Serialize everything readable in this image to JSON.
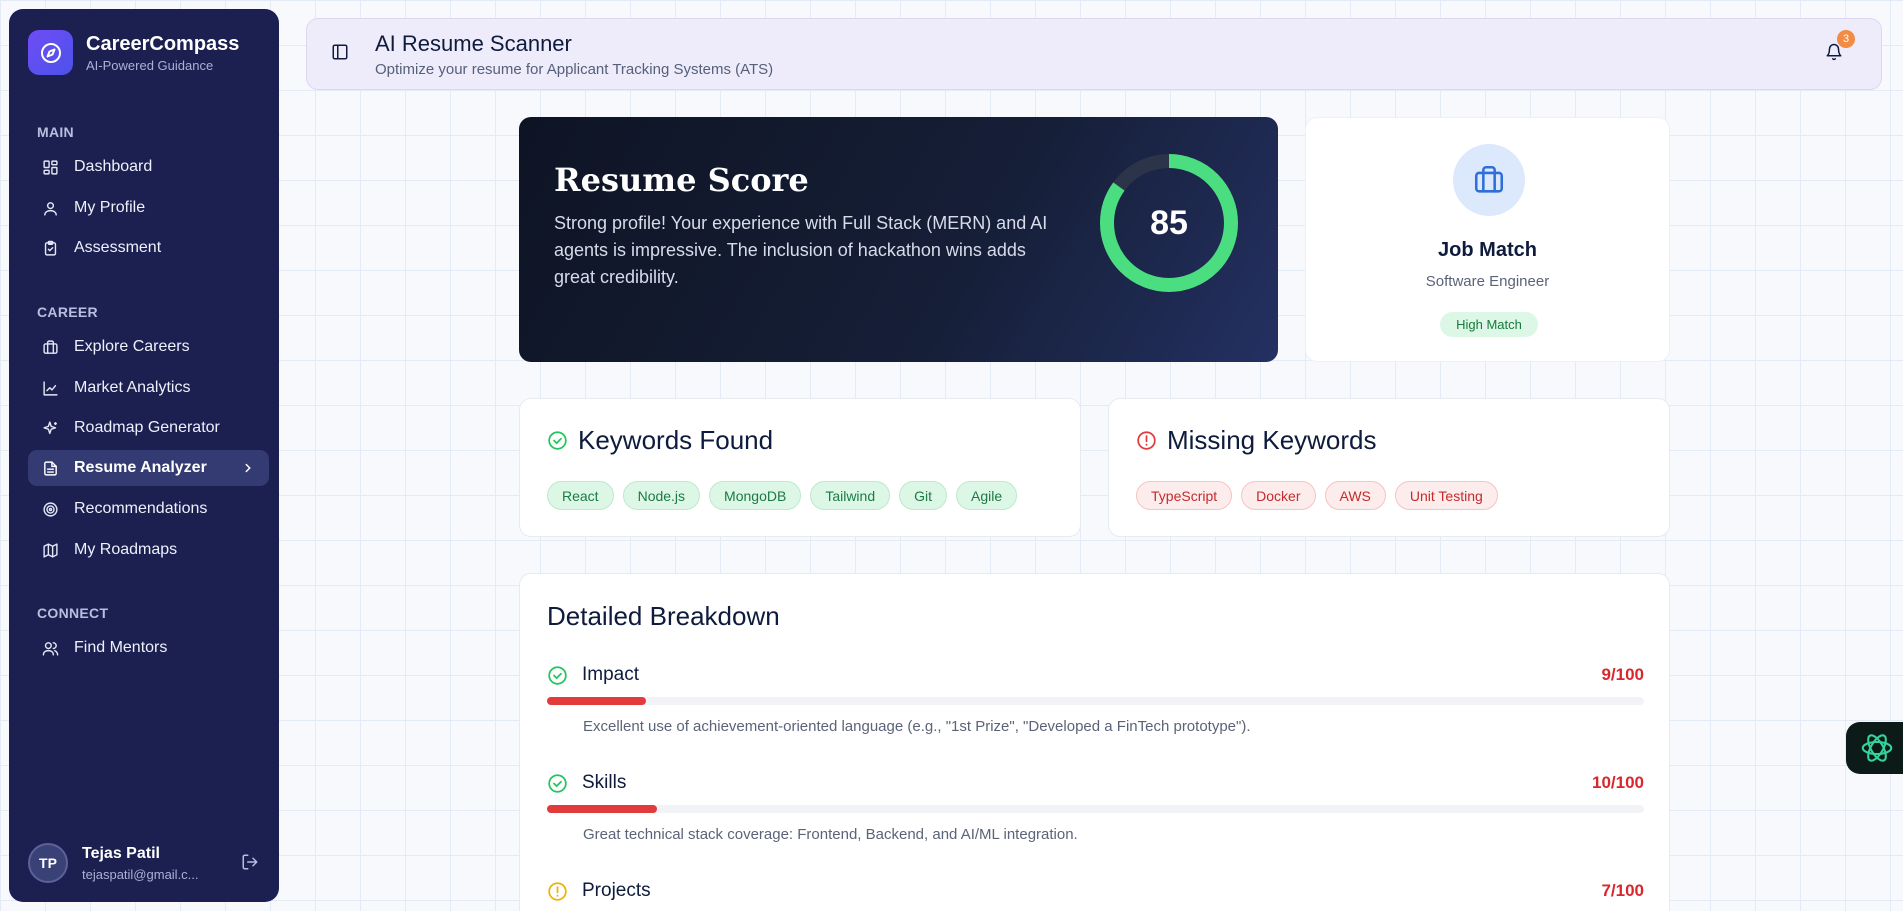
{
  "brand": {
    "name": "CareerCompass",
    "tagline": "AI-Powered Guidance"
  },
  "sidebar": {
    "sections": [
      {
        "title": "MAIN",
        "items": [
          {
            "label": "Dashboard",
            "icon": "dashboard-icon"
          },
          {
            "label": "My Profile",
            "icon": "user-icon"
          },
          {
            "label": "Assessment",
            "icon": "clipboard-icon"
          }
        ]
      },
      {
        "title": "CAREER",
        "items": [
          {
            "label": "Explore Careers",
            "icon": "briefcase-icon"
          },
          {
            "label": "Market Analytics",
            "icon": "chart-line-icon"
          },
          {
            "label": "Roadmap Generator",
            "icon": "sparkle-icon"
          },
          {
            "label": "Resume Analyzer",
            "icon": "document-icon",
            "active": true
          },
          {
            "label": "Recommendations",
            "icon": "target-icon"
          },
          {
            "label": "My Roadmaps",
            "icon": "map-icon"
          }
        ]
      },
      {
        "title": "CONNECT",
        "items": [
          {
            "label": "Find Mentors",
            "icon": "users-icon"
          }
        ]
      }
    ],
    "user": {
      "initials": "TP",
      "name": "Tejas Patil",
      "email": "tejaspatil@gmail.c..."
    }
  },
  "header": {
    "title": "AI Resume Scanner",
    "subtitle": "Optimize your resume for Applicant Tracking Systems (ATS)",
    "notification_count": "3"
  },
  "score_card": {
    "title": "Resume Score",
    "description": "Strong profile! Your experience with Full Stack (MERN) and AI agents is impressive. The inclusion of hackathon wins adds great credibility.",
    "score": "85",
    "score_fraction": 0.85,
    "ring_color": "#4ade80"
  },
  "job_match": {
    "title": "Job Match",
    "role": "Software Engineer",
    "badge": "High Match"
  },
  "keywords_found": {
    "title": "Keywords Found",
    "items": [
      "React",
      "Node.js",
      "MongoDB",
      "Tailwind",
      "Git",
      "Agile"
    ]
  },
  "missing_keywords": {
    "title": "Missing Keywords",
    "items": [
      "TypeScript",
      "Docker",
      "AWS",
      "Unit Testing"
    ]
  },
  "breakdown": {
    "title": "Detailed Breakdown",
    "items": [
      {
        "label": "Impact",
        "score": "9/100",
        "value": 9,
        "status": "good",
        "description": "Excellent use of achievement-oriented language (e.g., \"1st Prize\", \"Developed a FinTech prototype\")."
      },
      {
        "label": "Skills",
        "score": "10/100",
        "value": 10,
        "status": "good",
        "description": "Great technical stack coverage: Frontend, Backend, and AI/ML integration."
      },
      {
        "label": "Projects",
        "score": "7/100",
        "value": 7,
        "status": "warning",
        "description": ""
      }
    ]
  },
  "colors": {
    "accent": "#6f4cf6",
    "success": "#22c55e",
    "danger": "#e23b3b",
    "warning": "#eab308"
  }
}
